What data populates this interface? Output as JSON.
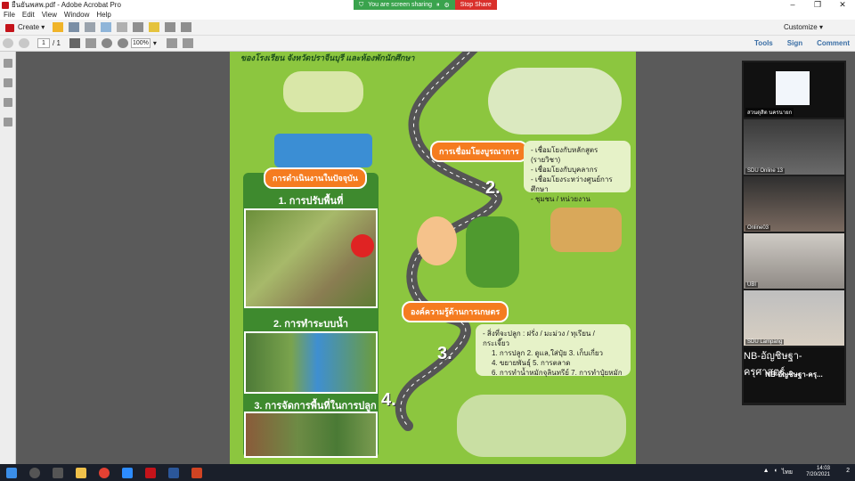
{
  "window": {
    "title": "ยืนยันพสพ.pdf - Adobe Acrobat Pro",
    "controls": [
      "–",
      "❐",
      "✕"
    ]
  },
  "sharing": {
    "message": "You are screen sharing",
    "stop_label": "Stop Share"
  },
  "menu": [
    "File",
    "Edit",
    "View",
    "Window",
    "Help"
  ],
  "toolbar": {
    "create_label": "Create",
    "customize_label": "Customize"
  },
  "nav": {
    "current_page": "1",
    "total_pages": "/ 1",
    "zoom": "100%",
    "tools_label": "Tools",
    "sign_label": "Sign",
    "comment_label": "Comment"
  },
  "poster": {
    "top_text": "ของโรงเรียน  จังหวัดปราจีนบุรี  และห้องพักนักศึกษา",
    "current_ops_label": "การดำเนินงานในปัจจุบัน",
    "section1": "1. การปรับพื้นที่",
    "section2": "2. การทำระบบน้ำ",
    "section3": "3. การจัดการพื้นที่ในการปลูก",
    "integration_label": "การเชื่อมโยงบูรณาการ",
    "integration_items": [
      "- เชื่อมโยงกับหลักสูตร (รายวิชา)",
      "- เชื่อมโยงกับบุคลากร",
      "- เชื่อมโยงระหว่างศูนย์การศึกษา",
      "- ชุมชน / หน่วยงาน"
    ],
    "knowledge_label": "องค์ความรู้ด้านการเกษตร",
    "knowledge_items": [
      "- สิ่งที่จะปลูก : ฝรั่ง / มะม่วง / ทุเรียน / กระเจี๊ยว",
      "1. การปลูก  2. ดูแล,ใส่ปุ๋ย  3. เก็บเกี่ยว",
      "4. ขยายพันธุ์  5. การตลาด",
      "6. การทำน้ำหมักจุลินทรีย์  7. การทำปุ๋ยหมัก"
    ],
    "num2": "2.",
    "num3": "3.",
    "num4": "4."
  },
  "participants": [
    {
      "name": "สวนดุสิต นครนายก",
      "type": "logo"
    },
    {
      "name": "SDU Online 13",
      "type": "video"
    },
    {
      "name": "Online03",
      "type": "video"
    },
    {
      "name": "UBI",
      "type": "video"
    },
    {
      "name": "SDU Lampang",
      "type": "video"
    },
    {
      "name": "NB-อัญชิษฐา-ครุ...",
      "sub": "NB-อัญชิษฐา-ครุศาสตร์...",
      "type": "name"
    }
  ],
  "taskbar": {
    "time": "14:03",
    "date": "7/20/2021",
    "lang": "ไทย",
    "notif": "2"
  },
  "colors": {
    "poster_bg": "#8cc63f",
    "orange_label": "#f57c20",
    "stop_red": "#d9302b",
    "share_green": "#3aa34d"
  }
}
